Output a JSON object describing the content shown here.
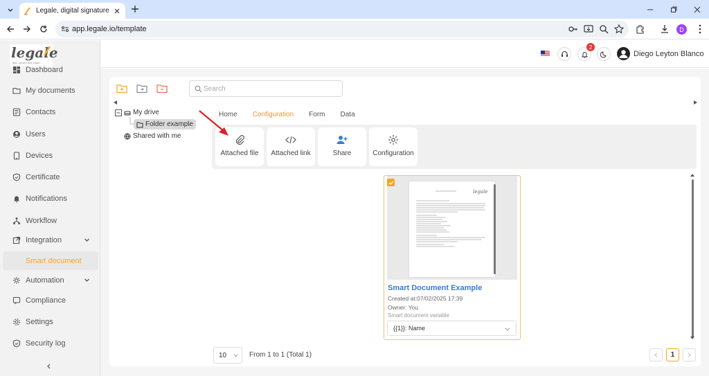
{
  "browser": {
    "tab_title": "Legale, digital signature",
    "url": "app.legale.io/template",
    "profile_initial": "D"
  },
  "logo": {
    "text": "legale",
    "subtitle": "fast, secure and smart"
  },
  "sidebar": {
    "items": [
      {
        "label": "Dashboard",
        "icon": "dashboard-icon"
      },
      {
        "label": "My documents",
        "icon": "folder-icon"
      },
      {
        "label": "Contacts",
        "icon": "contacts-icon"
      },
      {
        "label": "Users",
        "icon": "user-icon"
      },
      {
        "label": "Devices",
        "icon": "device-icon"
      },
      {
        "label": "Certificate",
        "icon": "shield-check-icon"
      },
      {
        "label": "Notifications",
        "icon": "bell-icon"
      },
      {
        "label": "Workflow",
        "icon": "workflow-icon"
      },
      {
        "label": "Integration",
        "icon": "external-link-icon"
      },
      {
        "label": "Smart document",
        "icon": "smart-doc-icon"
      },
      {
        "label": "Automation",
        "icon": "automation-icon"
      },
      {
        "label": "Compliance",
        "icon": "compliance-icon"
      },
      {
        "label": "Settings",
        "icon": "gear-icon"
      },
      {
        "label": "Security log",
        "icon": "shield-icon"
      }
    ],
    "active_index": 9
  },
  "header": {
    "notification_count": "2",
    "user_name": "Diego Leyton Blanco"
  },
  "search": {
    "placeholder": "Search"
  },
  "tree": {
    "root": "My drive",
    "child": "Folder example",
    "shared": "Shared with me"
  },
  "tabs": [
    "Home",
    "Configuration",
    "Form",
    "Data"
  ],
  "active_tab": 1,
  "actions": [
    "Attached file",
    "Attached link",
    "Share",
    "Configuration"
  ],
  "document": {
    "title": "Smart Document Example",
    "created": "Created at:07/02/2025 17:39",
    "owner": "Owner: You",
    "variable_label": "Smart document variable",
    "variable_value": "{{1}}: Name"
  },
  "pagination": {
    "page_size": "10",
    "range": "From 1 to 1 (Total 1)",
    "current_page": "1"
  },
  "colors": {
    "accent": "#f5a623",
    "link": "#3a7bd5",
    "arrow": "#e02020"
  }
}
